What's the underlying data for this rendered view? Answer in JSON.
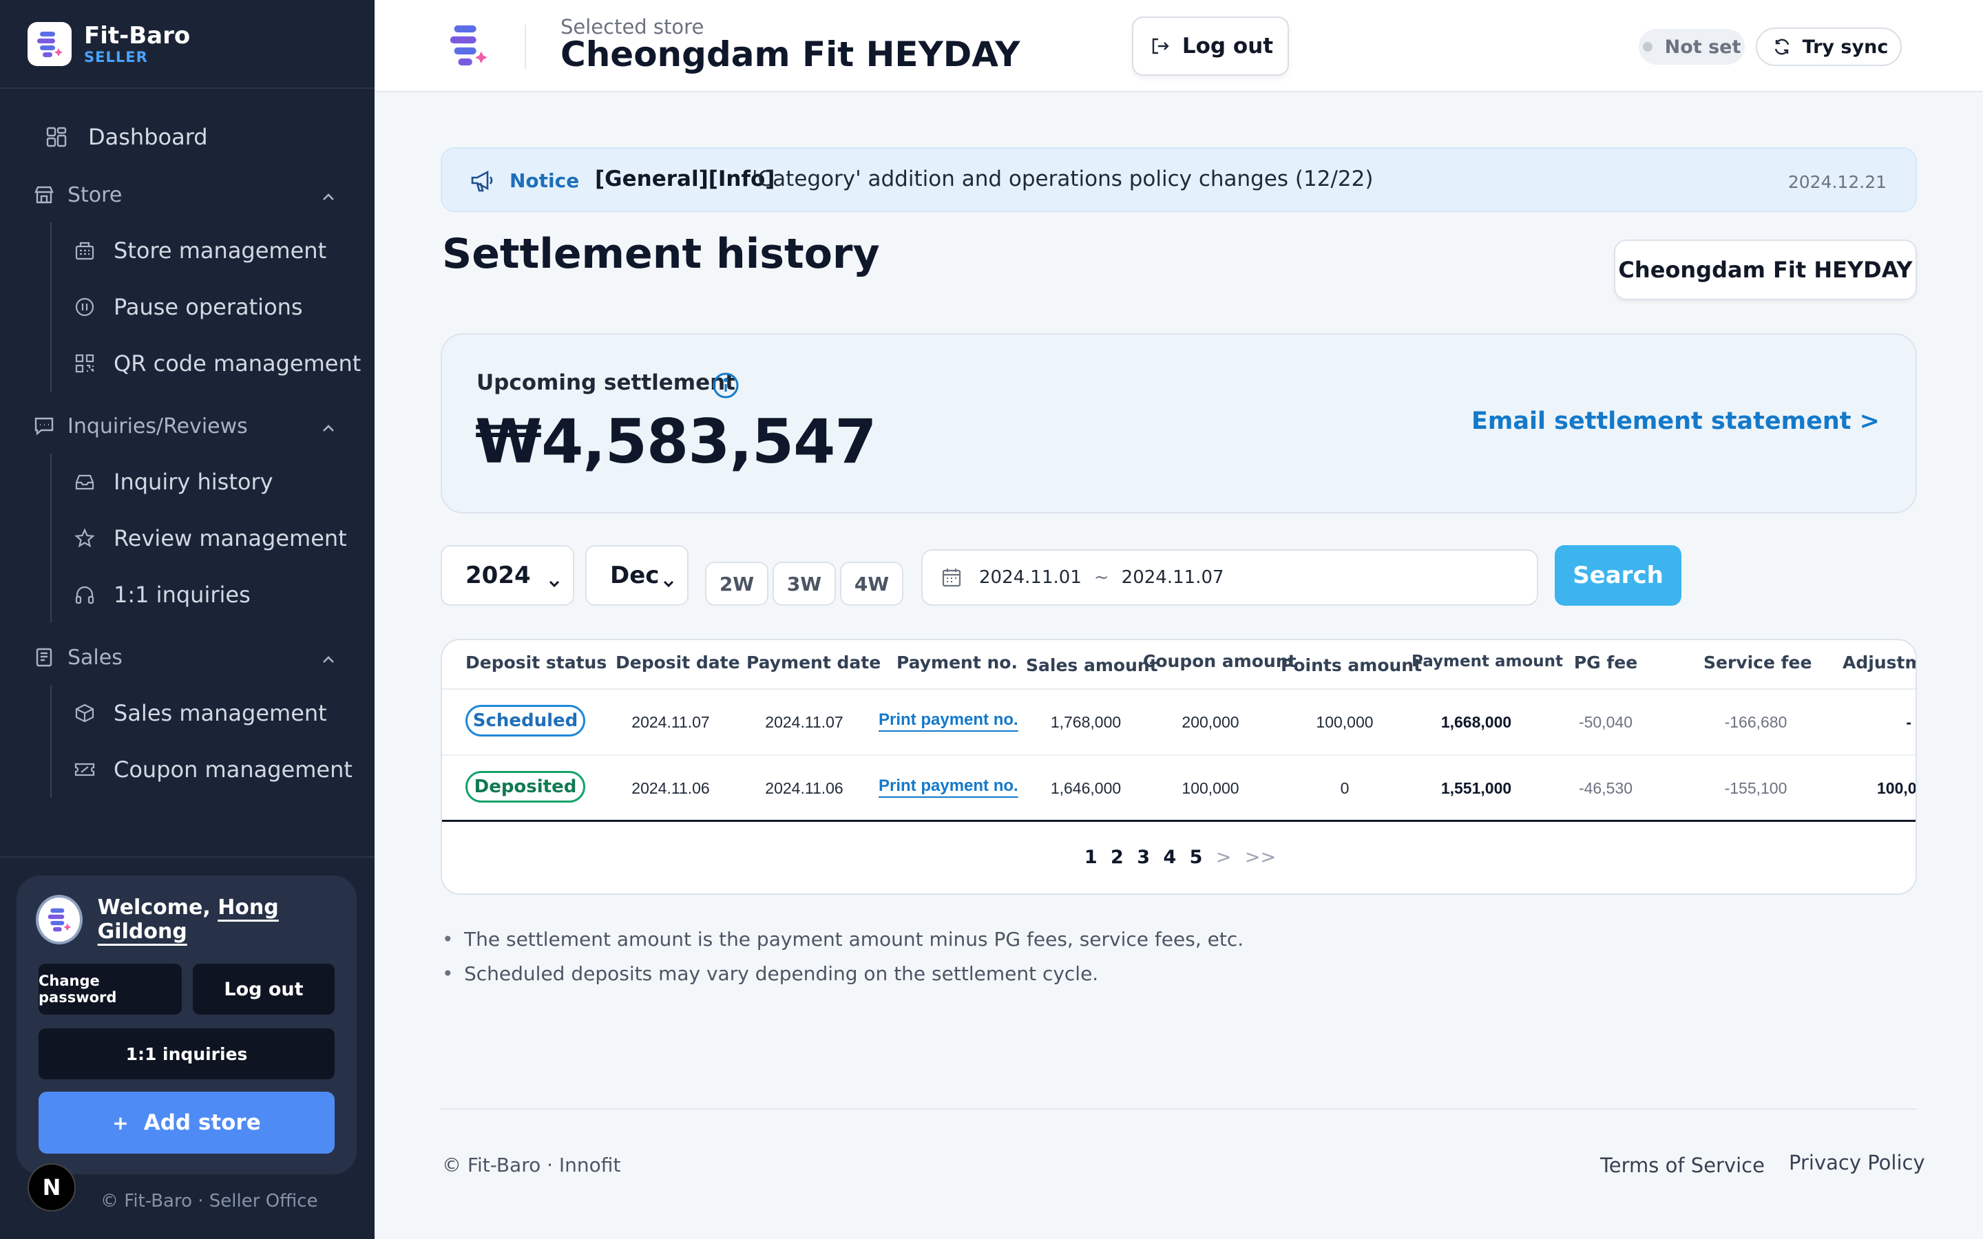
{
  "brand": {
    "name": "Fit-Baro",
    "sub": "SELLER"
  },
  "nav": {
    "dashboard": "Dashboard",
    "store": {
      "title": "Store",
      "items": [
        "Store management",
        "Pause operations",
        "QR code management"
      ]
    },
    "inquiries": {
      "title": "Inquiries/Reviews",
      "items": [
        "Inquiry history",
        "Review management",
        "1:1 inquiries"
      ]
    },
    "sales": {
      "title": "Sales",
      "items": [
        "Sales management",
        "Coupon management"
      ]
    }
  },
  "user": {
    "welcome": "Welcome,",
    "name": "Hong Gildong",
    "change_password": "Change password",
    "logout": "Log out",
    "inquiries": "1:1 inquiries",
    "add_store_plus": "+",
    "add_store": "Add store"
  },
  "next_badge": "N",
  "sidebar_footer": "© Fit-Baro · Seller Office",
  "header": {
    "selected_label": "Selected store",
    "store_name": "Cheongdam Fit HEYDAY",
    "logout": "Log out",
    "status": "Not set",
    "sync": "Try sync"
  },
  "notice": {
    "label": "Notice",
    "tag": "[General][Info]",
    "text": "'Category' addition and operations policy changes (12/22)",
    "date": "2024.12.21"
  },
  "page": {
    "title": "Settlement history",
    "store_chip": "Cheongdam Fit HEYDAY"
  },
  "upcoming": {
    "label": "Upcoming settlement",
    "amount": "₩4,583,547",
    "email_link": "Email settlement statement >"
  },
  "filters": {
    "year": "2024",
    "month": "Dec",
    "weeks": [
      "2W",
      "3W",
      "4W"
    ],
    "date_from": "2024.11.01",
    "date_sep": "~",
    "date_to": "2024.11.07",
    "search": "Search"
  },
  "table": {
    "headers": [
      "Deposit status",
      "Deposit date",
      "Payment date",
      "Payment no.",
      "Sales amount",
      "Coupon amount",
      "Points amount",
      "Payment amount",
      "PG fee",
      "Service fee",
      "Adjustm"
    ],
    "rows": [
      {
        "status": "Scheduled",
        "deposit_date": "2024.11.07",
        "payment_date": "2024.11.07",
        "payment_no": "Print payment no.",
        "sales": "1,768,000",
        "coupon": "200,000",
        "points": "100,000",
        "payment": "1,668,000",
        "pg_fee": "-50,040",
        "service_fee": "-166,680",
        "adjust": "-"
      },
      {
        "status": "Deposited",
        "deposit_date": "2024.11.06",
        "payment_date": "2024.11.06",
        "payment_no": "Print payment no.",
        "sales": "1,646,000",
        "coupon": "100,000",
        "points": "0",
        "payment": "1,551,000",
        "pg_fee": "-46,530",
        "service_fee": "-155,100",
        "adjust": "100,0"
      }
    ],
    "pages": [
      "1",
      "2",
      "3",
      "4",
      "5"
    ],
    "next": ">",
    "last": ">>"
  },
  "notes": [
    "The settlement amount is the payment amount minus PG fees, service fees, etc.",
    "Scheduled deposits may vary depending on the settlement cycle."
  ],
  "footer": {
    "copyright": "© Fit-Baro · Innofit",
    "terms": "Terms of Service",
    "privacy": "Privacy Policy"
  },
  "colors": {
    "sidebar": "#1b2436",
    "accent": "#3db4ee",
    "link": "#1479c9",
    "primary_button": "#4f8bf5"
  }
}
